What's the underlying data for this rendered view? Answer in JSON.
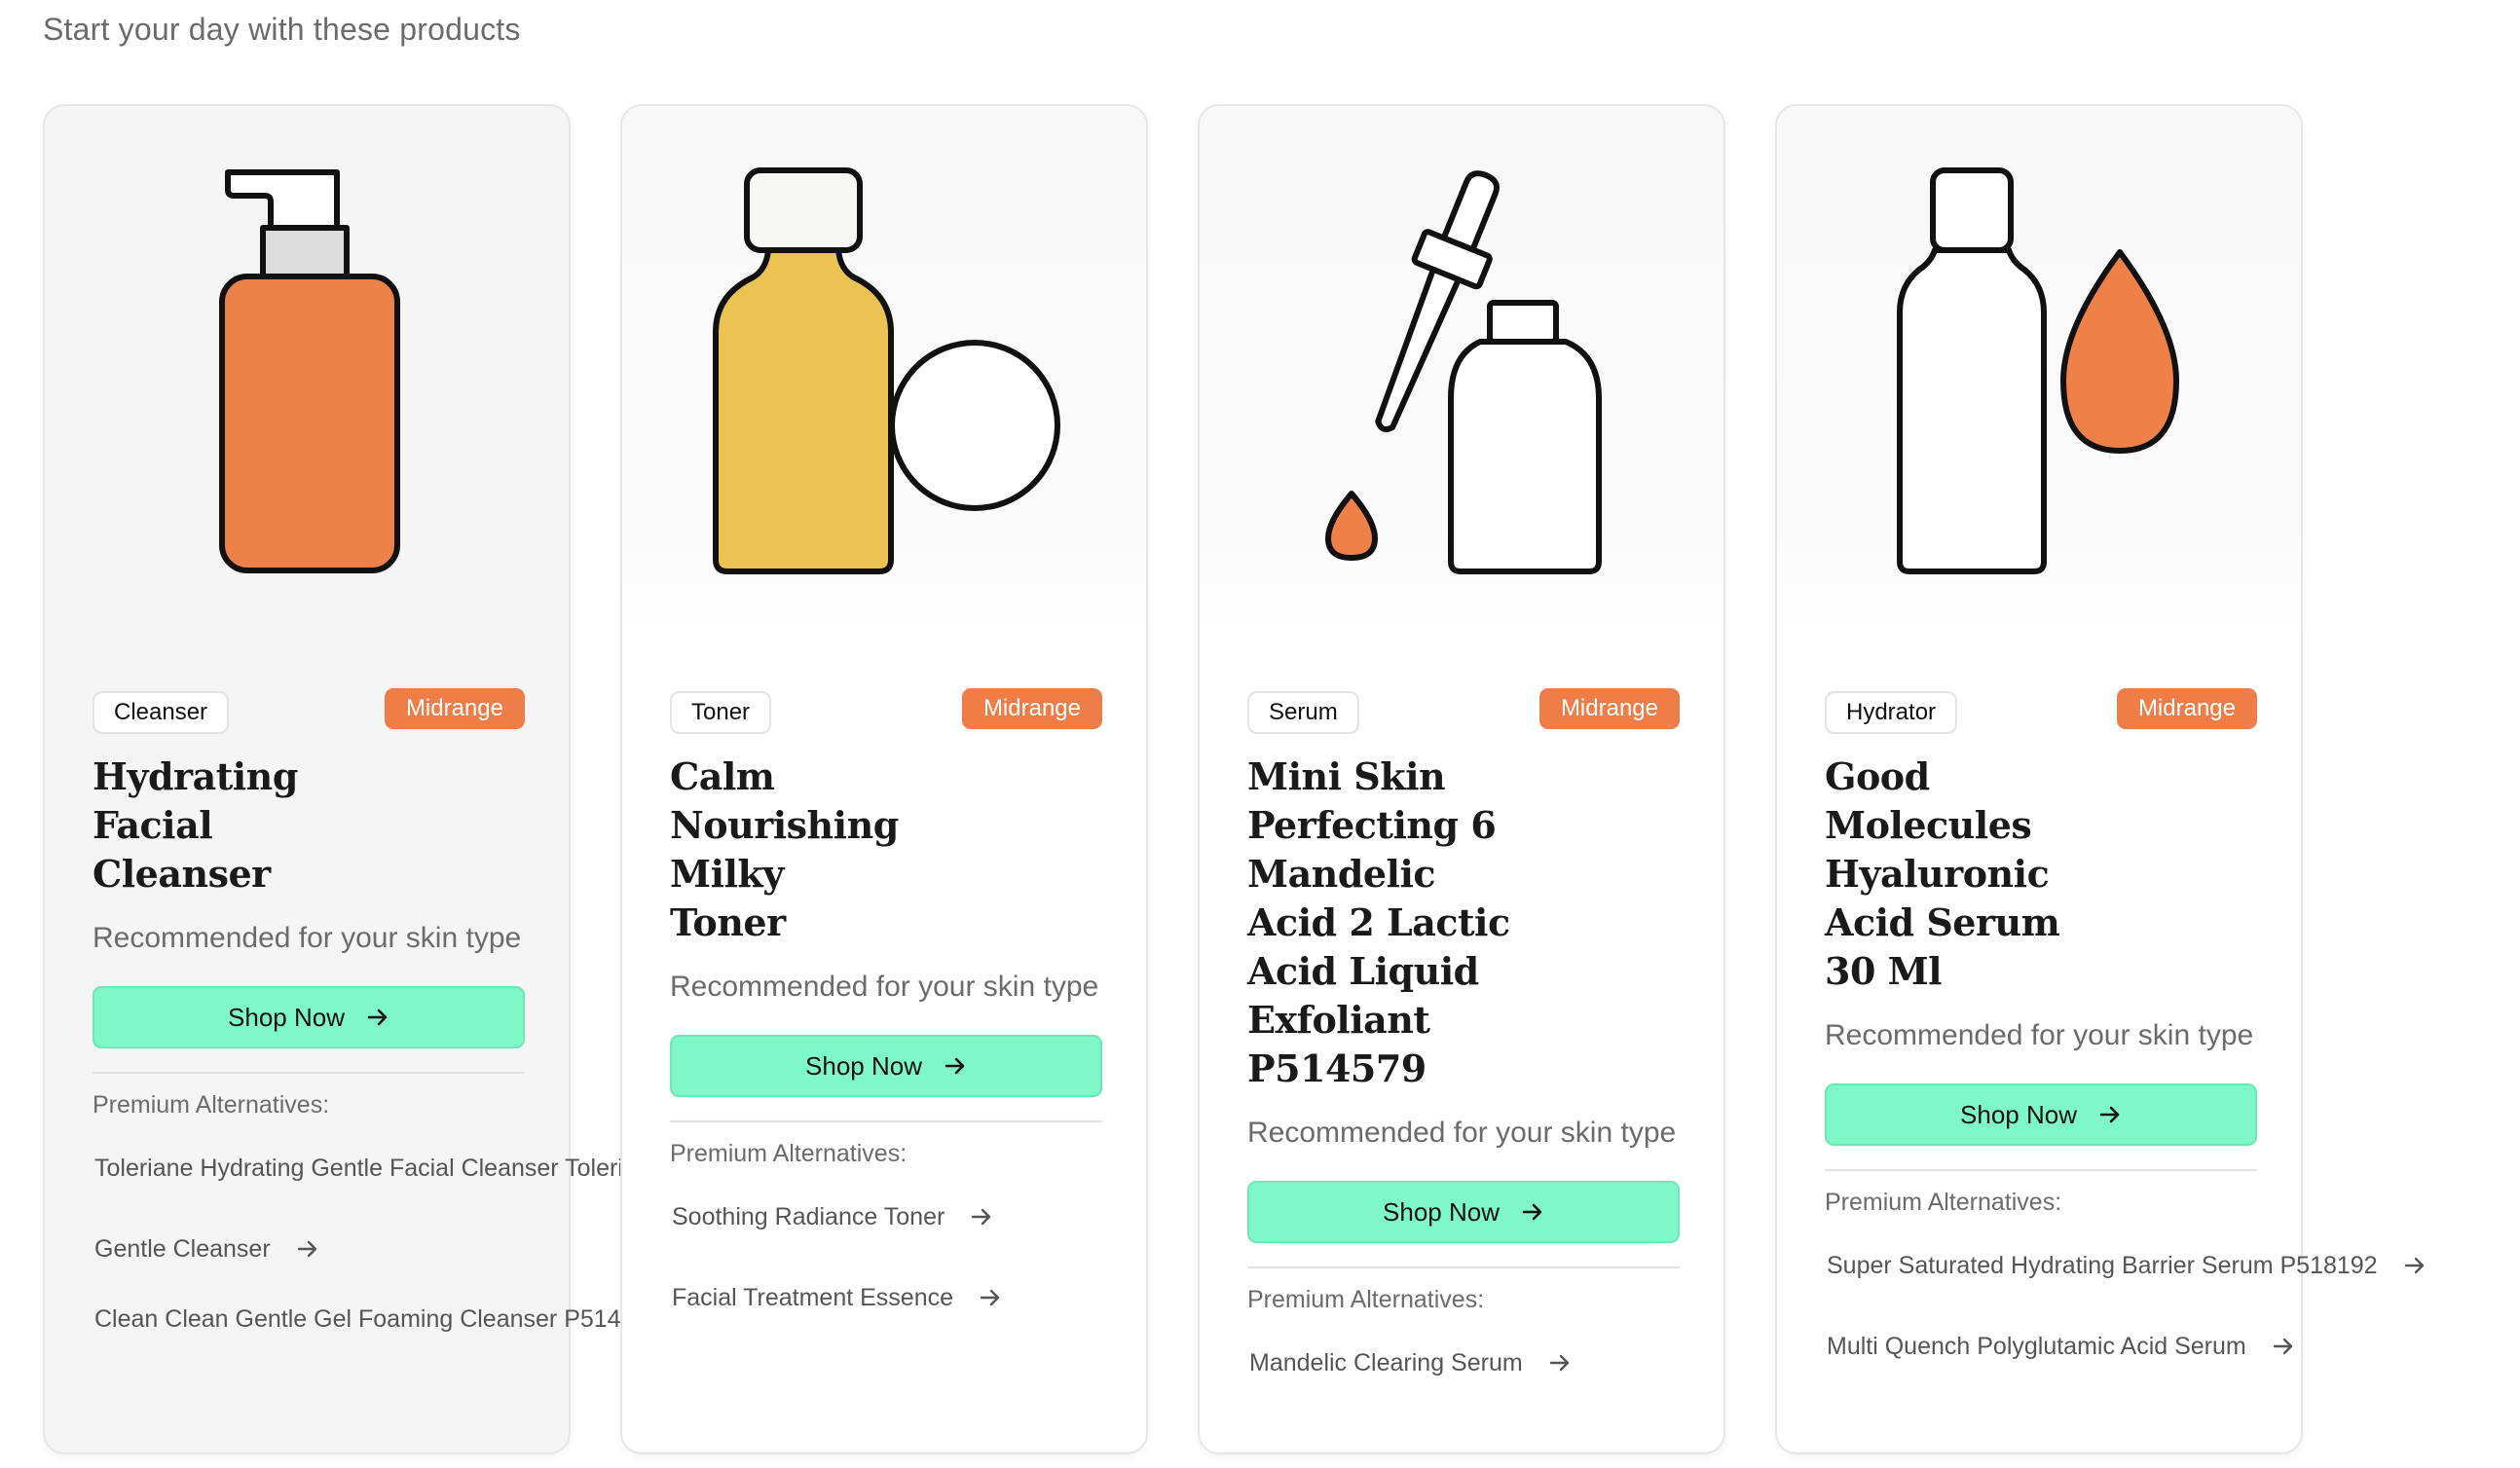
{
  "heading": "Start your day with these products",
  "colors": {
    "price_badge": "#ee7d47",
    "shop_button": "#7ef8c9",
    "cleanser_bottle": "#ec8149",
    "toner_bottle": "#ecc353",
    "serum_drop": "#ef8148",
    "hydrator_drop": "#ef8148"
  },
  "products": [
    {
      "category": "Cleanser",
      "price_tier": "Midrange",
      "title": "Hydrating Facial Cleanser",
      "recommendation": "Recommended for your skin type",
      "shop_label": "Shop Now",
      "premium_label": "Premium Alternatives:",
      "illustration": "pump-bottle-icon",
      "alternatives": [
        "Toleriane Hydrating Gentle Facial Cleanser Toleriane Hydrating Gentle Facial Cleanser",
        "Gentle Cleanser",
        "Clean Clean Gentle Gel Foaming Cleanser P514"
      ]
    },
    {
      "category": "Toner",
      "price_tier": "Midrange",
      "title": "Calm Nourishing Milky Toner",
      "recommendation": "Recommended for your skin type",
      "shop_label": "Shop Now",
      "premium_label": "Premium Alternatives:",
      "illustration": "toner-bottle-icon",
      "alternatives": [
        "Soothing Radiance Toner",
        "Facial Treatment Essence"
      ]
    },
    {
      "category": "Serum",
      "price_tier": "Midrange",
      "title": "Mini Skin Perfecting 6 Mandelic Acid 2 Lactic Acid Liquid Exfoliant P514579",
      "recommendation": "Recommended for your skin type",
      "shop_label": "Shop Now",
      "premium_label": "Premium Alternatives:",
      "illustration": "dropper-bottle-icon",
      "alternatives": [
        "Mandelic Clearing Serum"
      ]
    },
    {
      "category": "Hydrator",
      "price_tier": "Midrange",
      "title": "Good Molecules Hyaluronic Acid Serum 30 Ml",
      "recommendation": "Recommended for your skin type",
      "shop_label": "Shop Now",
      "premium_label": "Premium Alternatives:",
      "illustration": "bottle-with-drop-icon",
      "alternatives": [
        "Super Saturated Hydrating Barrier Serum P518192",
        "Multi Quench Polyglutamic Acid Serum"
      ]
    }
  ]
}
